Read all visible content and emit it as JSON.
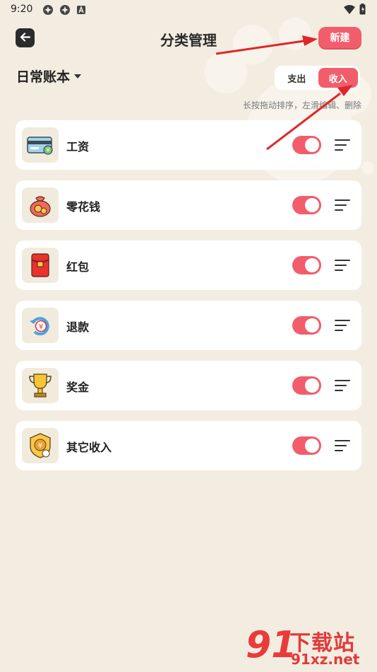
{
  "status_bar": {
    "time": "9:20"
  },
  "header": {
    "title": "分类管理",
    "new_button": "新建"
  },
  "book": {
    "name": "日常账本"
  },
  "type_toggle": {
    "tabs": [
      "支出",
      "收入"
    ],
    "active": "收入"
  },
  "hint": "长按拖动排序，左滑编辑、删除",
  "categories": [
    {
      "label": "工资",
      "icon": "salary-card-icon",
      "enabled": true
    },
    {
      "label": "零花钱",
      "icon": "money-bag-icon",
      "enabled": true
    },
    {
      "label": "红包",
      "icon": "red-envelope-icon",
      "enabled": true
    },
    {
      "label": "退款",
      "icon": "refund-icon",
      "enabled": true
    },
    {
      "label": "奖金",
      "icon": "trophy-icon",
      "enabled": true
    },
    {
      "label": "其它收入",
      "icon": "other-income-icon",
      "enabled": true
    }
  ],
  "watermark": {
    "number": "91",
    "text": "下载站",
    "url": "91xz.net"
  },
  "colors": {
    "accent": "#f25d6c",
    "background": "#f3ede1",
    "card": "#ffffff"
  }
}
